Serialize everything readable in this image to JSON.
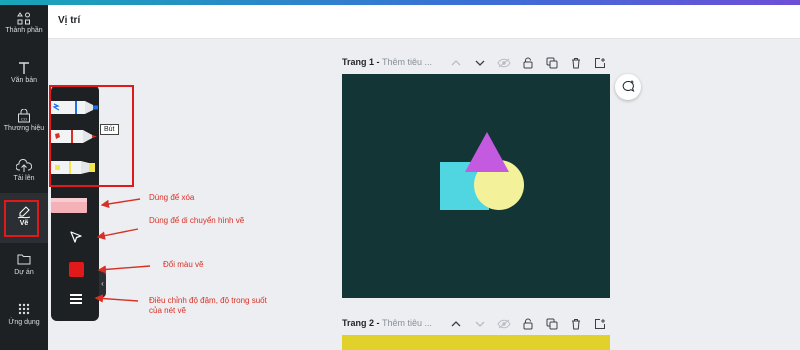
{
  "header": {
    "title": "Vị trí"
  },
  "nav": {
    "items": [
      {
        "label": "Thành phần",
        "icon": "elements-icon"
      },
      {
        "label": "Văn bản",
        "icon": "text-icon"
      },
      {
        "label": "Thương hiệu",
        "icon": "brand-icon"
      },
      {
        "label": "Tải lên",
        "icon": "upload-icon"
      },
      {
        "label": "Vẽ",
        "icon": "draw-icon"
      },
      {
        "label": "Dự án",
        "icon": "folder-icon"
      },
      {
        "label": "Ứng dụng",
        "icon": "apps-icon"
      }
    ],
    "active": "Vẽ"
  },
  "draw_panel": {
    "tooltip": "Bút",
    "pens": [
      {
        "name": "marker",
        "tip_color": "#1a73e8"
      },
      {
        "name": "pen",
        "tip_color": "#d93025"
      },
      {
        "name": "highlighter",
        "tip_color": "#f2e64a"
      }
    ],
    "eraser_color": "#f4b2b8",
    "current_color": "#e0191b"
  },
  "annotations": {
    "eraser": "Dùng để xóa",
    "move": "Dùng để di chuyển hình vẽ",
    "color": "Đổi màu vẽ",
    "weight": "Điều chỉnh độ đậm, độ trong suốt của nét vẽ"
  },
  "pages": [
    {
      "name": "Trang 1",
      "subtitle": "Thêm tiêu ...",
      "background": "#133536"
    },
    {
      "name": "Trang 2",
      "subtitle": "Thêm tiêu ...",
      "background": "#e0d22b"
    }
  ],
  "design": {
    "shapes": [
      {
        "type": "square",
        "color": "#4fd6e0"
      },
      {
        "type": "circle",
        "color": "#f3f29a"
      },
      {
        "type": "triangle",
        "color": "#c45ae0"
      }
    ]
  },
  "colors": {
    "annotation": "#d93025",
    "highlight_box": "#e0191b"
  }
}
